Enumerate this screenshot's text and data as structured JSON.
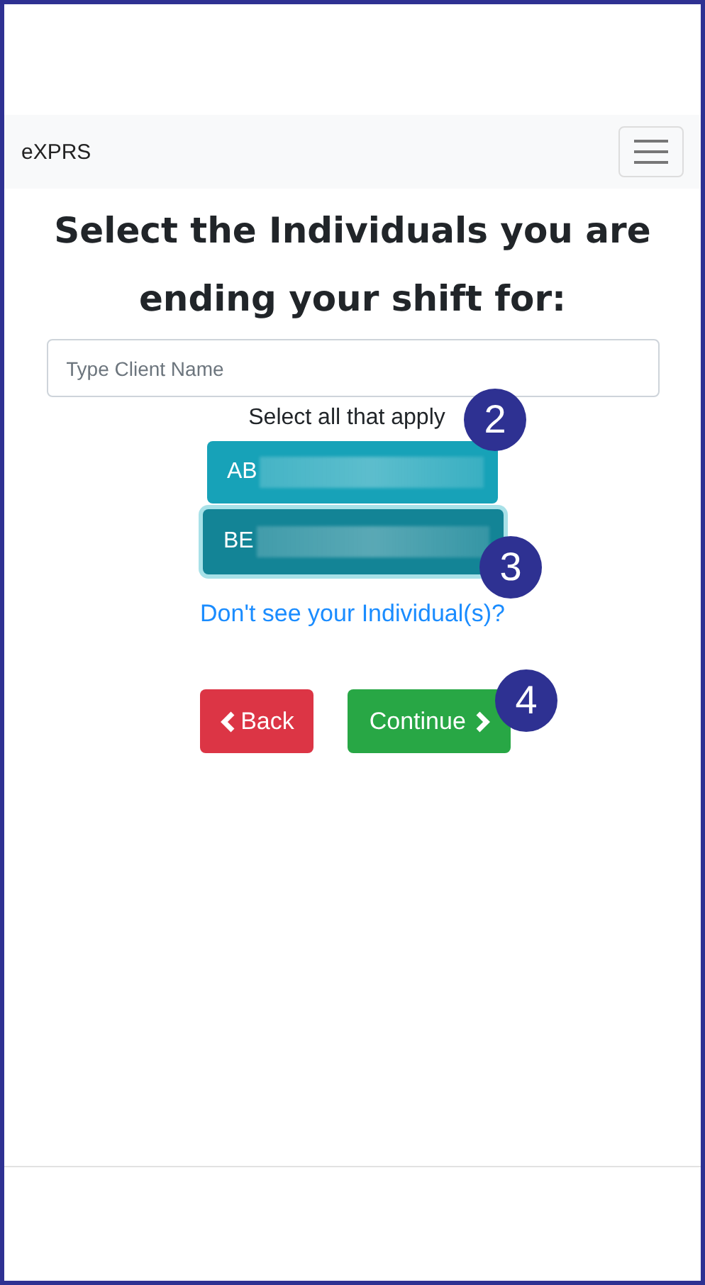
{
  "navbar": {
    "brand": "eXPRS"
  },
  "heading": "Select the Individuals you are ending your shift for:",
  "search": {
    "placeholder": "Type Client Name"
  },
  "instruction": "Select all that apply",
  "individuals": [
    {
      "label": "AB",
      "selected": false
    },
    {
      "label": "BE",
      "selected": true
    }
  ],
  "help_link": "Don't see your Individual(s)?",
  "buttons": [
    {
      "kind": "back",
      "label": "Back"
    },
    {
      "kind": "continue",
      "label": "Continue"
    }
  ],
  "callouts": [
    "2",
    "3",
    "4"
  ]
}
